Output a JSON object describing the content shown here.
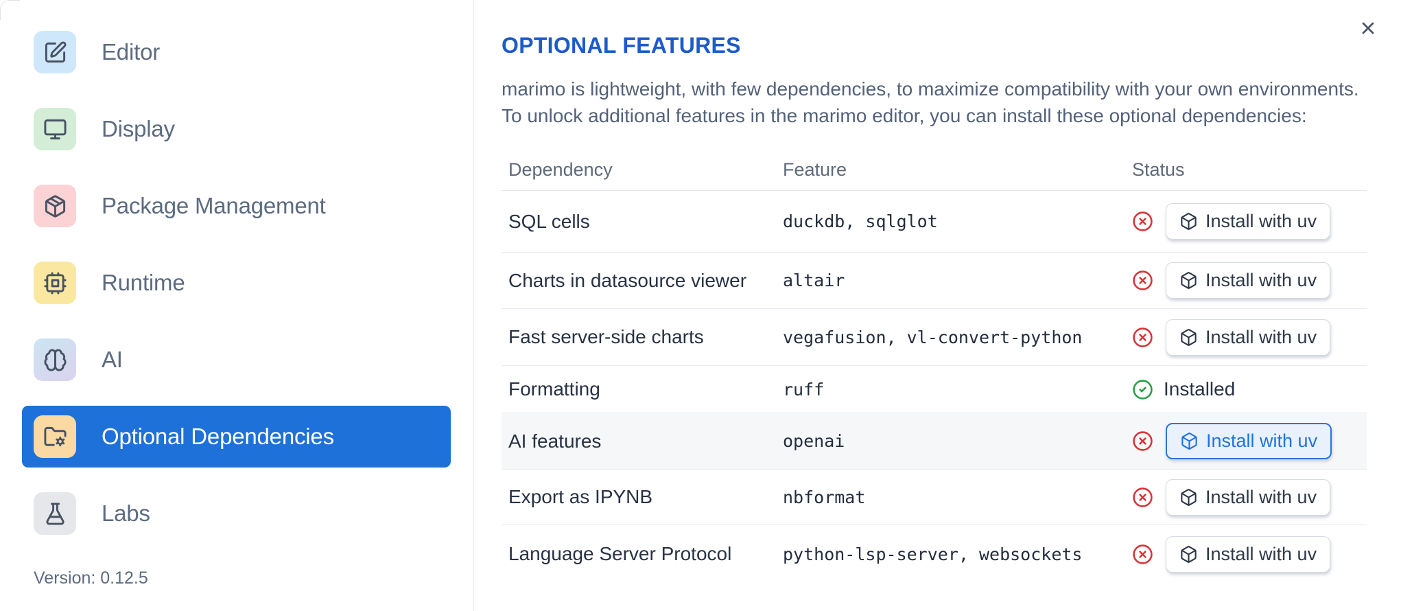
{
  "sidebar": {
    "items": [
      {
        "label": "Editor",
        "icon": "square-pen",
        "icon_bg": "#cfe7fb"
      },
      {
        "label": "Display",
        "icon": "monitor",
        "icon_bg": "#d3edd6"
      },
      {
        "label": "Package Management",
        "icon": "package",
        "icon_bg": "#fcd2d4"
      },
      {
        "label": "Runtime",
        "icon": "cpu",
        "icon_bg": "#fbe8a0"
      },
      {
        "label": "AI",
        "icon": "brain",
        "icon_bg": "linear-gradient(150deg,#cbe5f2 0%,#dbd3ee 100%)"
      },
      {
        "label": "Optional Dependencies",
        "icon": "folder-cog",
        "icon_bg": "#fbd9a2",
        "selected": true
      },
      {
        "label": "Labs",
        "icon": "flask-conical",
        "icon_bg": "#e6e7ea"
      }
    ],
    "version_label": "Version: 0.12.5"
  },
  "panel": {
    "title": "OPTIONAL FEATURES",
    "description": [
      "marimo is lightweight, with few dependencies, to maximize compatibility with your own environments.",
      "To unlock additional features in the marimo editor, you can install these optional dependencies:"
    ],
    "close_icon": "x-icon",
    "table": {
      "columns": [
        "Dependency",
        "Feature",
        "Status"
      ],
      "install_button_label": "Install with uv",
      "installed_label": "Installed",
      "rows": [
        {
          "dependency": "SQL cells",
          "feature": "duckdb, sqlglot",
          "installed": false
        },
        {
          "dependency": "Charts in datasource viewer",
          "feature": "altair",
          "installed": false
        },
        {
          "dependency": "Fast server-side charts",
          "feature": "vegafusion, vl-convert-python",
          "installed": false
        },
        {
          "dependency": "Formatting",
          "feature": "ruff",
          "installed": true
        },
        {
          "dependency": "AI features",
          "feature": "openai",
          "installed": false,
          "highlighted": true
        },
        {
          "dependency": "Export as IPYNB",
          "feature": "nbformat",
          "installed": false
        },
        {
          "dependency": "Language Server Protocol",
          "feature": "python-lsp-server, websockets",
          "installed": false
        }
      ]
    }
  },
  "colors": {
    "selected_item_bg": "#1e71d8",
    "title_blue": "#1d5bc9",
    "missing_red": "#d63438",
    "installed_green": "#2a9d45",
    "highlight_button_bg": "#e9f1fc",
    "highlight_button_border": "#2d74d4",
    "highlight_button_text": "#2173dd"
  }
}
